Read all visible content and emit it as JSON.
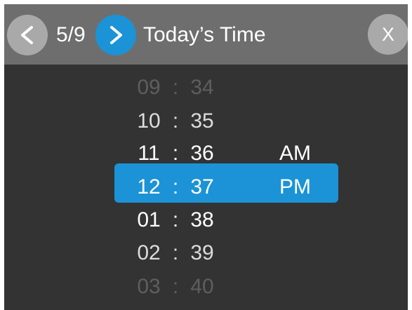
{
  "header": {
    "prev_icon": "chevron-left-icon",
    "counter": "5/9",
    "next_icon": "chevron-right-icon",
    "title": "Today’s Time",
    "close_label": "X"
  },
  "colors": {
    "header_bg": "#6e6e6e",
    "body_bg": "#333333",
    "accent": "#1b93d6",
    "inactive_button": "#a9a9a9",
    "faint_text": "#5e5e5e"
  },
  "time_picker": {
    "separator": ":",
    "rows": [
      {
        "hour": "09",
        "minute": "34",
        "period": ""
      },
      {
        "hour": "10",
        "minute": "35",
        "period": ""
      },
      {
        "hour": "11",
        "minute": "36",
        "period": "AM"
      },
      {
        "hour": "12",
        "minute": "37",
        "period": "PM"
      },
      {
        "hour": "01",
        "minute": "38",
        "period": ""
      },
      {
        "hour": "02",
        "minute": "39",
        "period": ""
      },
      {
        "hour": "03",
        "minute": "40",
        "period": ""
      }
    ],
    "selected": {
      "hour": "12",
      "minute": "37",
      "period": "PM"
    }
  }
}
